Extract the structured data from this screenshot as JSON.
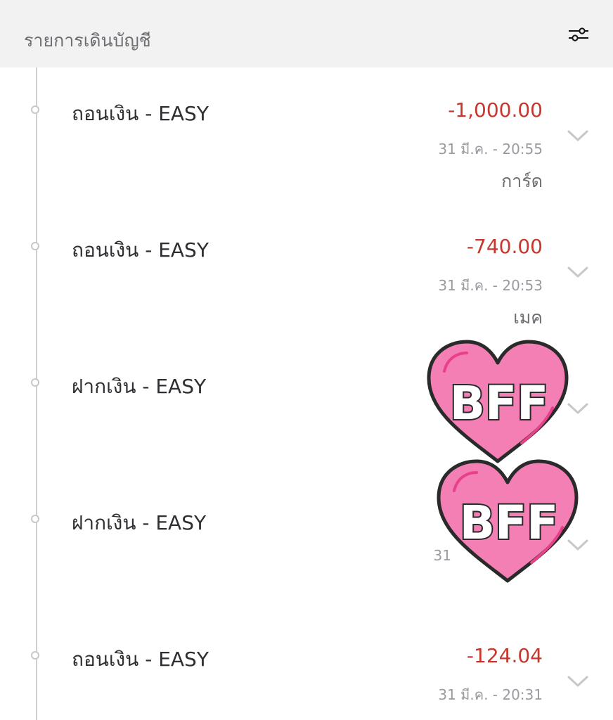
{
  "header": {
    "title": "รายการเดินบัญชี",
    "filter_icon": "sliders-icon"
  },
  "transactions": [
    {
      "title": "ถอนเงิน - EASY",
      "amount": "-1,000.00",
      "datetime": "31 มี.ค. - 20:55",
      "note": "การ์ด"
    },
    {
      "title": "ถอนเงิน - EASY",
      "amount": "-740.00",
      "datetime": "31 มี.ค. - 20:53",
      "note": "เมค"
    },
    {
      "title": "ฝากเงิน - EASY",
      "amount": "",
      "datetime": "",
      "note": ""
    },
    {
      "title": "ฝากเงิน - EASY",
      "amount": "",
      "datetime": "31",
      "note": ""
    },
    {
      "title": "ถอนเงิน - EASY",
      "amount": "-124.04",
      "datetime": "31 มี.ค. - 20:31",
      "note": ""
    }
  ],
  "stickers": [
    {
      "text": "BFF",
      "icon": "heart-sticker-icon"
    },
    {
      "text": "BFF",
      "icon": "heart-sticker-icon"
    }
  ],
  "colors": {
    "header_bg": "#f2f2f3",
    "debit": "#c8372d",
    "sticker_pink": "#f47fb4"
  }
}
